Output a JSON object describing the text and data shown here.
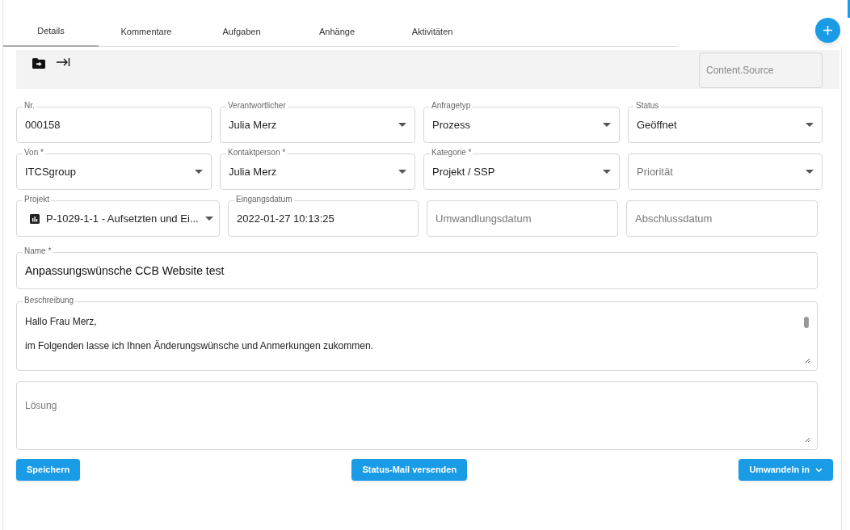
{
  "tabs": [
    {
      "label": "Details",
      "selected": true
    },
    {
      "label": "Kommentare",
      "selected": false
    },
    {
      "label": "Aufgaben",
      "selected": false
    },
    {
      "label": "Anhänge",
      "selected": false
    },
    {
      "label": "Aktivitäten",
      "selected": false
    }
  ],
  "toolbar": {
    "source_placeholder": "Content.Source"
  },
  "field_rows": [
    [
      {
        "kind": "text",
        "label": "Nr.",
        "value": "000158"
      },
      {
        "kind": "select",
        "label": "Verantwortlicher",
        "value": "Julia Merz"
      },
      {
        "kind": "select",
        "label": "Anfragetyp",
        "value": "Prozess"
      },
      {
        "kind": "select",
        "label": "Status",
        "value": "Geöffnet"
      }
    ],
    [
      {
        "kind": "select",
        "label": "Von *",
        "value": "ITCSgroup"
      },
      {
        "kind": "select",
        "label": "Kontaktperson *",
        "value": "Julia Merz"
      },
      {
        "kind": "select",
        "label": "Kategorie *",
        "value": "Projekt / SSP"
      },
      {
        "kind": "select",
        "placeholder": "Priorität"
      }
    ],
    [
      {
        "kind": "project",
        "label": "Projekt",
        "value": "P-1029-1-1 - Aufsetzten und Ei..."
      },
      {
        "kind": "text",
        "label": "Eingangsdatum",
        "value": "2022-01-27 10:13:25"
      },
      {
        "kind": "text",
        "placeholder": "Umwandlungsdatum"
      },
      {
        "kind": "text",
        "placeholder": "Abschlussdatum"
      }
    ]
  ],
  "name": {
    "label": "Name *",
    "value": "Anpassungswünsche CCB Website test"
  },
  "description": {
    "label": "Beschreibung",
    "lines": [
      "Hallo Frau Merz,",
      "im Folgenden lasse ich Ihnen Änderungswünsche und Anmerkungen zukommen."
    ]
  },
  "solution": {
    "placeholder": "Lösung"
  },
  "buttons": [
    {
      "label": "Speichern",
      "kind": "plain"
    },
    {
      "label": "Status-Mail versenden",
      "kind": "plain"
    },
    {
      "label": "Umwandeln in",
      "kind": "menu"
    }
  ]
}
